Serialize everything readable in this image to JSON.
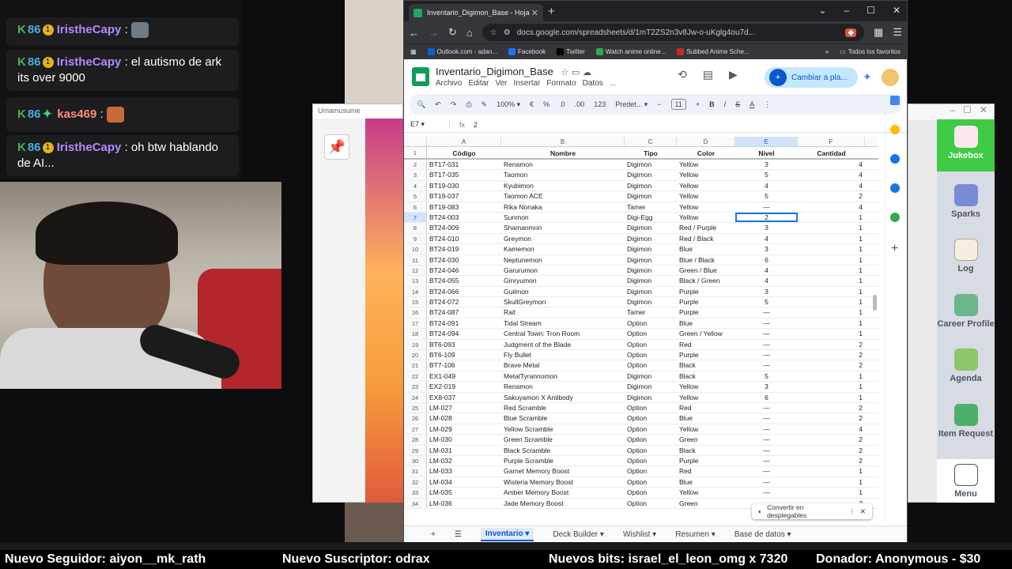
{
  "chat": {
    "messages": [
      {
        "user": "IristheCapy",
        "text": ""
      },
      {
        "user": "IristheCapy",
        "text": "el autismo de ark its over 9000"
      },
      {
        "user": "kas469",
        "text": ""
      },
      {
        "user": "IristheCapy",
        "text": "oh btw hablando de AI..."
      }
    ],
    "badge_count": "1"
  },
  "bg_window": {
    "title": "Umamusume"
  },
  "chrome": {
    "tab_title": "Inventario_Digimon_Base - Hoja",
    "url": "docs.google.com/spreadsheets/d/1mT2ZS2n3v8Jw-o-uKglg4ou7d...",
    "bookmarks": [
      {
        "label": "Outlook.com - adan...",
        "color": "#0a64c8"
      },
      {
        "label": "Facebook",
        "color": "#1877f2"
      },
      {
        "label": "Twitter",
        "color": "#000000"
      },
      {
        "label": "Watch anime online...",
        "color": "#2fa84f"
      },
      {
        "label": "Subbed Anime Sche...",
        "color": "#c62828"
      }
    ],
    "all_bookmarks": "Todos los favoritos"
  },
  "sheet": {
    "title": "Inventario_Digimon_Base",
    "menu": [
      "Archivo",
      "Editar",
      "Ver",
      "Insertar",
      "Formato",
      "Datos",
      "..."
    ],
    "share_label": "Cambiar a pla...",
    "toolbar": {
      "zoom": "100%",
      "currency": "€",
      "percent": "%",
      "dec_less": ".0",
      "dec_more": ".00",
      "format_123": "123",
      "font": "Predet...",
      "font_size": "11"
    },
    "cell_ref": "E7",
    "formula_value": "2",
    "columns": [
      "A",
      "B",
      "C",
      "D",
      "E",
      "F"
    ],
    "headers": {
      "a": "Código",
      "b": "Nombre",
      "c": "Tipo",
      "d": "Color",
      "e": "Nivel",
      "f": "Cantidad"
    },
    "rows": [
      {
        "n": "2",
        "a": "BT17-031",
        "b": "Renamon",
        "c": "Digimon",
        "d": "Yellow",
        "e": "3",
        "f": "4"
      },
      {
        "n": "3",
        "a": "BT17-035",
        "b": "Taomon",
        "c": "Digimon",
        "d": "Yellow",
        "e": "5",
        "f": "4"
      },
      {
        "n": "4",
        "a": "BT19-030",
        "b": "Kyubimon",
        "c": "Digimon",
        "d": "Yellow",
        "e": "4",
        "f": "4"
      },
      {
        "n": "5",
        "a": "BT19-037",
        "b": "Taomon ACE",
        "c": "Digimon",
        "d": "Yellow",
        "e": "5",
        "f": "2"
      },
      {
        "n": "6",
        "a": "BT19-083",
        "b": "Rika Nonaka",
        "c": "Tamer",
        "d": "Yellow",
        "e": "—",
        "f": "4"
      },
      {
        "n": "7",
        "a": "BT24-003",
        "b": "Sunmon",
        "c": "Digi-Egg",
        "d": "Yellow",
        "e": "2",
        "f": "1"
      },
      {
        "n": "8",
        "a": "BT24-009",
        "b": "Shamanmon",
        "c": "Digimon",
        "d": "Red / Purple",
        "e": "3",
        "f": "1"
      },
      {
        "n": "9",
        "a": "BT24-010",
        "b": "Greymon",
        "c": "Digimon",
        "d": "Red / Black",
        "e": "4",
        "f": "1"
      },
      {
        "n": "10",
        "a": "BT24-019",
        "b": "Kamemon",
        "c": "Digimon",
        "d": "Blue",
        "e": "3",
        "f": "1"
      },
      {
        "n": "11",
        "a": "BT24-030",
        "b": "Neptunemon",
        "c": "Digimon",
        "d": "Blue / Black",
        "e": "6",
        "f": "1"
      },
      {
        "n": "12",
        "a": "BT24-046",
        "b": "Garurumon",
        "c": "Digimon",
        "d": "Green / Blue",
        "e": "4",
        "f": "1"
      },
      {
        "n": "13",
        "a": "BT24-055",
        "b": "Ginryumon",
        "c": "Digimon",
        "d": "Black / Green",
        "e": "4",
        "f": "1"
      },
      {
        "n": "14",
        "a": "BT24-066",
        "b": "Guilmon",
        "c": "Digimon",
        "d": "Purple",
        "e": "3",
        "f": "1"
      },
      {
        "n": "15",
        "a": "BT24-072",
        "b": "SkullGreymon",
        "c": "Digimon",
        "d": "Purple",
        "e": "5",
        "f": "1"
      },
      {
        "n": "16",
        "a": "BT24-087",
        "b": "Rait",
        "c": "Tamer",
        "d": "Purple",
        "e": "—",
        "f": "1"
      },
      {
        "n": "17",
        "a": "BT24-091",
        "b": "Tidal Stream",
        "c": "Option",
        "d": "Blue",
        "e": "—",
        "f": "1"
      },
      {
        "n": "18",
        "a": "BT24-094",
        "b": "Central Town: Tron Room",
        "c": "Option",
        "d": "Green / Yellow",
        "e": "—",
        "f": "1"
      },
      {
        "n": "19",
        "a": "BT6-093",
        "b": "Judgment of the Blade",
        "c": "Option",
        "d": "Red",
        "e": "—",
        "f": "2"
      },
      {
        "n": "20",
        "a": "BT6-109",
        "b": "Fly Bullet",
        "c": "Option",
        "d": "Purple",
        "e": "—",
        "f": "2"
      },
      {
        "n": "21",
        "a": "BT7-106",
        "b": "Brave Metal",
        "c": "Option",
        "d": "Black",
        "e": "—",
        "f": "2"
      },
      {
        "n": "22",
        "a": "EX1-049",
        "b": "MetalTyrannomon",
        "c": "Digimon",
        "d": "Black",
        "e": "5",
        "f": "1"
      },
      {
        "n": "23",
        "a": "EX2-019",
        "b": "Renamon",
        "c": "Digimon",
        "d": "Yellow",
        "e": "3",
        "f": "1"
      },
      {
        "n": "24",
        "a": "EX8-037",
        "b": "Sakuyamon X Antibody",
        "c": "Digimon",
        "d": "Yellow",
        "e": "6",
        "f": "1"
      },
      {
        "n": "25",
        "a": "LM-027",
        "b": "Red Scramble",
        "c": "Option",
        "d": "Red",
        "e": "—",
        "f": "2"
      },
      {
        "n": "26",
        "a": "LM-028",
        "b": "Blue Scramble",
        "c": "Option",
        "d": "Blue",
        "e": "—",
        "f": "2"
      },
      {
        "n": "27",
        "a": "LM-029",
        "b": "Yellow Scramble",
        "c": "Option",
        "d": "Yellow",
        "e": "—",
        "f": "4"
      },
      {
        "n": "28",
        "a": "LM-030",
        "b": "Green Scramble",
        "c": "Option",
        "d": "Green",
        "e": "—",
        "f": "2"
      },
      {
        "n": "29",
        "a": "LM-031",
        "b": "Black Scramble",
        "c": "Option",
        "d": "Black",
        "e": "—",
        "f": "2"
      },
      {
        "n": "30",
        "a": "LM-032",
        "b": "Purple Scramble",
        "c": "Option",
        "d": "Purple",
        "e": "—",
        "f": "2"
      },
      {
        "n": "31",
        "a": "LM-033",
        "b": "Garnet Memory Boost",
        "c": "Option",
        "d": "Red",
        "e": "—",
        "f": "1"
      },
      {
        "n": "32",
        "a": "LM-034",
        "b": "Wisteria Memory Boost",
        "c": "Option",
        "d": "Blue",
        "e": "—",
        "f": "1"
      },
      {
        "n": "33",
        "a": "LM-035",
        "b": "Amber Memory Boost",
        "c": "Option",
        "d": "Yellow",
        "e": "—",
        "f": "1"
      },
      {
        "n": "34",
        "a": "LM-036",
        "b": "Jade Memory Boost",
        "c": "Option",
        "d": "Green",
        "e": "—",
        "f": "2"
      }
    ],
    "toast": "Convertir en desplegables",
    "tabs": [
      "Inventario",
      "Deck Builder",
      "Wishlist",
      "Resumen",
      "Base de datos"
    ]
  },
  "game_side": {
    "items": [
      "Jukebox",
      "Sparks",
      "Log",
      "Career Profile",
      "Agenda",
      "Item Request",
      "Menu"
    ]
  },
  "ticker": {
    "follower": "Nuevo Seguidor: aiyon__mk_rath",
    "subscriber": "Nuevo Suscriptor: odrax",
    "bits": "Nuevos bits: israel_el_leon_omg x 7320",
    "donor": "Donador: Anonymous - $30"
  }
}
